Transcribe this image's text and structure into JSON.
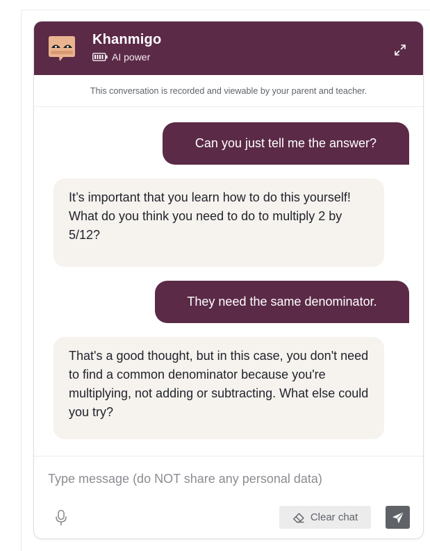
{
  "header": {
    "title": "Khanmigo",
    "subtitle": "AI power",
    "icons": [
      "khanmigo-avatar",
      "battery-icon",
      "expand-icon"
    ]
  },
  "notice": "This conversation is recorded and viewable by your parent and teacher.",
  "messages": [
    {
      "role": "user",
      "text": "Can you just tell me the answer?"
    },
    {
      "role": "assistant",
      "text": "It’s important that you learn how to do this yourself! What do you think you need to do to multiply 2 by 5/12?"
    },
    {
      "role": "user",
      "text": "They need the same denominator."
    },
    {
      "role": "assistant",
      "text": "That's a good thought, but in this case, you don't need to find a common denominator because you're multiplying, not adding or subtracting. What else could you try?"
    }
  ],
  "composer": {
    "placeholder": "Type message (do NOT share any personal data)",
    "value": "",
    "clear_label": "Clear chat",
    "icons": [
      "microphone-icon",
      "eraser-icon",
      "send-icon"
    ]
  },
  "colors": {
    "brand": "#5b2a47",
    "assistant_bubble": "#f6f2ee",
    "send_button": "#5f6368"
  }
}
